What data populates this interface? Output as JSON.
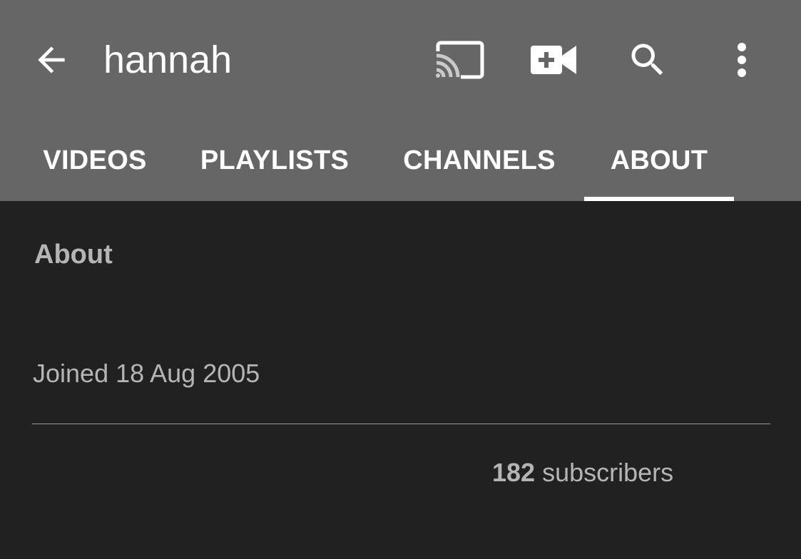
{
  "header": {
    "title": "hannah",
    "icons": {
      "back": "arrow-back-icon",
      "cast": "cast-icon",
      "upload": "video-upload-icon",
      "search": "search-icon",
      "more": "more-vert-icon"
    },
    "background": "#666666"
  },
  "tabs": [
    {
      "label": "VIDEOS",
      "selected": false
    },
    {
      "label": "PLAYLISTS",
      "selected": false
    },
    {
      "label": "CHANNELS",
      "selected": false
    },
    {
      "label": "ABOUT",
      "selected": true
    }
  ],
  "about": {
    "heading": "About",
    "joined": "Joined 18 Aug 2005",
    "subscriber_count": "182",
    "subscriber_label": " subscribers"
  },
  "colors": {
    "content_bg": "#212121",
    "text_secondary": "#b5b5b5",
    "tab_indicator": "#ffffff"
  }
}
